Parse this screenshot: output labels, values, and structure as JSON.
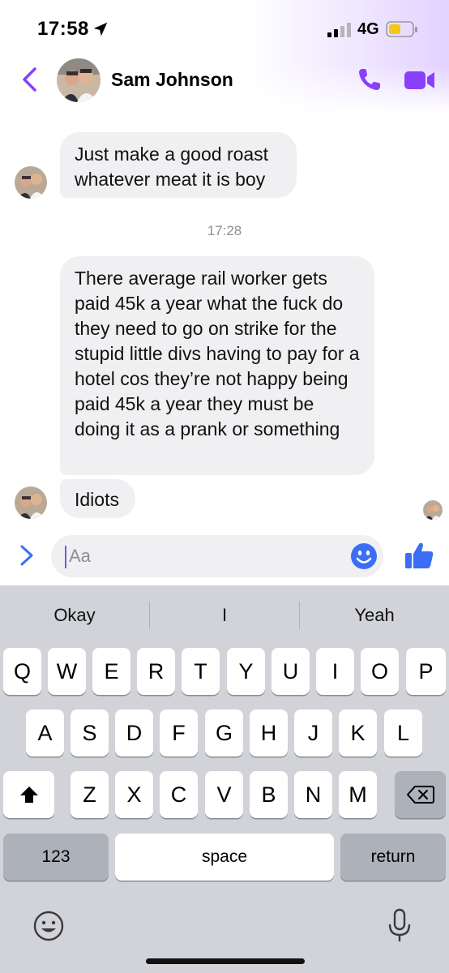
{
  "status_bar": {
    "time": "17:58",
    "network": "4G"
  },
  "header": {
    "contact_name": "Sam Johnson"
  },
  "messages": [
    {
      "text": "Just make a good roast whatever meat it is boy"
    },
    {
      "text": "There average rail worker gets paid 45k a year what the fuck do they need to go on strike for the stupid little divs having to pay for a hotel cos they’re not happy being paid 45k a year they must be doing it as a prank or something"
    },
    {
      "text": "Idiots"
    }
  ],
  "timestamp": "17:28",
  "composer": {
    "placeholder": "Aa"
  },
  "keyboard": {
    "suggestions": [
      "Okay",
      "I",
      "Yeah"
    ],
    "row1": [
      "Q",
      "W",
      "E",
      "R",
      "T",
      "Y",
      "U",
      "I",
      "O",
      "P"
    ],
    "row2": [
      "A",
      "S",
      "D",
      "F",
      "G",
      "H",
      "J",
      "K",
      "L"
    ],
    "row3": [
      "Z",
      "X",
      "C",
      "V",
      "B",
      "N",
      "M"
    ],
    "numbers_label": "123",
    "space_label": "space",
    "return_label": "return"
  },
  "colors": {
    "accent": "#8a3ffc",
    "like_blue": "#3b6ef5",
    "bubble": "#f0f0f2",
    "keyboard_bg": "#d1d3d9"
  }
}
